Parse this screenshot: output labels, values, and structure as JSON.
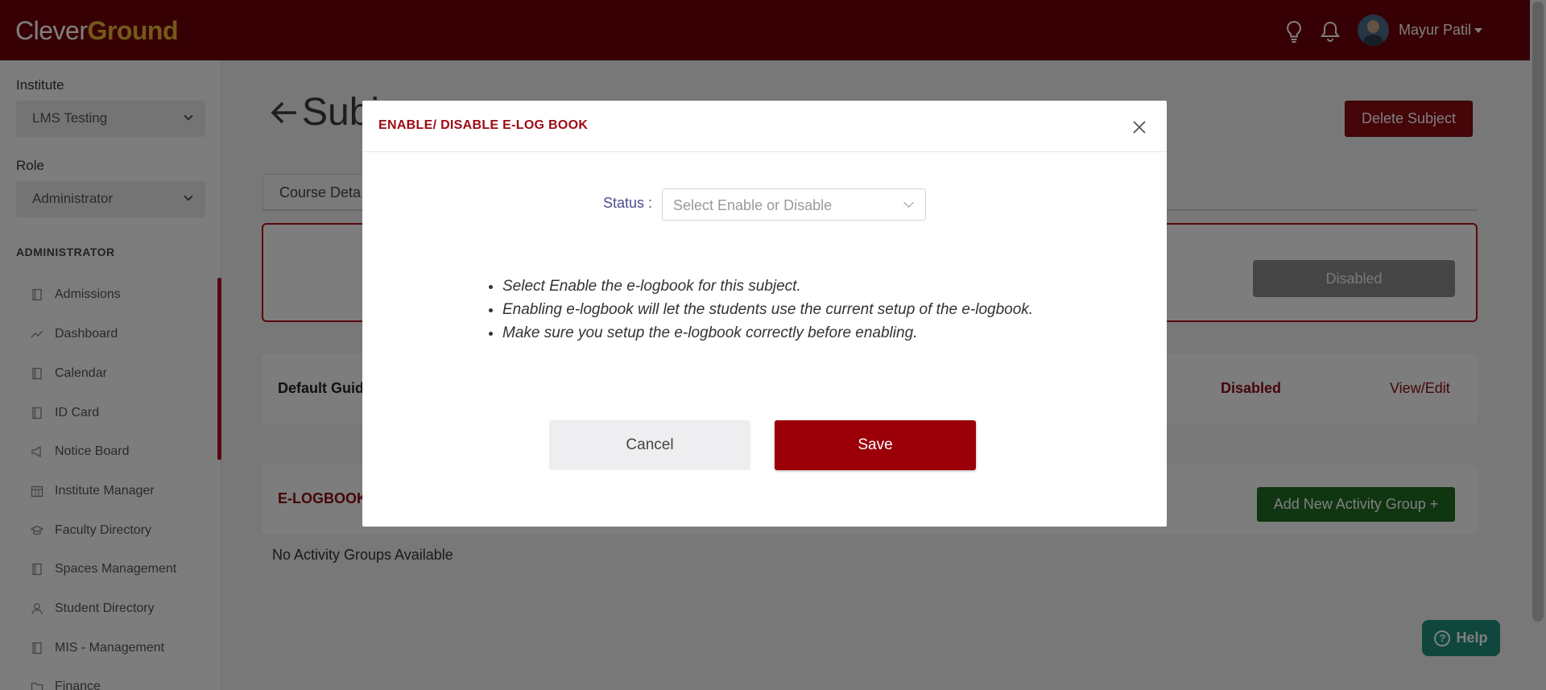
{
  "header": {
    "logo_part1": "Clever",
    "logo_part2": "Ground",
    "user_name": "Mayur Patil"
  },
  "sidebar": {
    "institute_label": "Institute",
    "institute_value": "LMS Testing",
    "role_label": "Role",
    "role_value": "Administrator",
    "section_title": "ADMINISTRATOR",
    "items": [
      {
        "label": "Admissions",
        "icon": "book-icon"
      },
      {
        "label": "Dashboard",
        "icon": "trend-icon"
      },
      {
        "label": "Calendar",
        "icon": "book-icon"
      },
      {
        "label": "ID Card",
        "icon": "book-icon"
      },
      {
        "label": "Notice Board",
        "icon": "megaphone-icon"
      },
      {
        "label": "Institute Manager",
        "icon": "calendar-grid-icon"
      },
      {
        "label": "Faculty Directory",
        "icon": "graduation-cap-icon"
      },
      {
        "label": "Spaces Management",
        "icon": "book-icon"
      },
      {
        "label": "Student Directory",
        "icon": "user-icon"
      },
      {
        "label": "MIS - Management",
        "icon": "book-icon"
      },
      {
        "label": "Finance",
        "icon": "folder-icon"
      }
    ]
  },
  "main": {
    "title_visible": "Subj",
    "delete_label": "Delete Subject",
    "tab_label": "Course Deta",
    "elogbook_status_button": "Disabled",
    "guide_label": "Default Guid",
    "guide_status": "Disabled",
    "guide_action": "View/Edit",
    "elogbook_label": "E-LOGBOOK",
    "add_group_label": "Add New Activity Group +",
    "no_groups_text": "No Activity Groups Available",
    "help_label": "Help"
  },
  "modal": {
    "title": "ENABLE/ DISABLE E-LOG BOOK",
    "status_label": "Status :",
    "status_placeholder": "Select Enable or Disable",
    "notes": [
      "Select Enable the e-logbook for this subject.",
      "Enabling e-logbook will let the students use the current setup of the e-logbook.",
      "Make sure you setup the e-logbook correctly before enabling."
    ],
    "cancel_label": "Cancel",
    "save_label": "Save"
  },
  "colors": {
    "brand": "#6e0008",
    "accent": "#9b0008",
    "logo_gold": "#e8b536",
    "success": "#1f6b23",
    "help": "#1f8f7b"
  }
}
